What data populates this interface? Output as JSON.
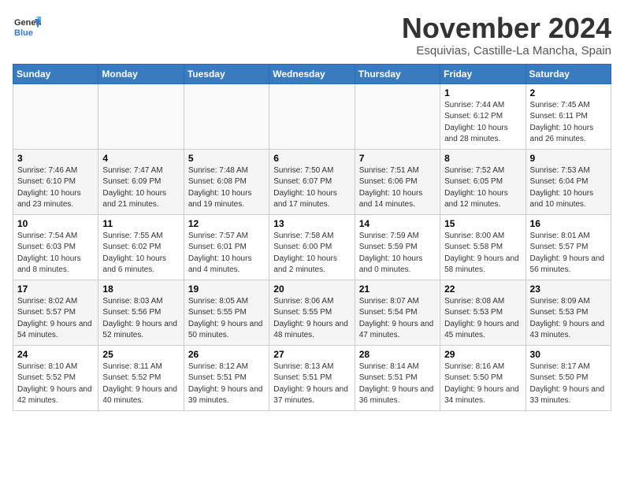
{
  "header": {
    "logo_line1": "General",
    "logo_line2": "Blue",
    "month_year": "November 2024",
    "location": "Esquivias, Castille-La Mancha, Spain"
  },
  "weekdays": [
    "Sunday",
    "Monday",
    "Tuesday",
    "Wednesday",
    "Thursday",
    "Friday",
    "Saturday"
  ],
  "weeks": [
    [
      {
        "day": "",
        "info": ""
      },
      {
        "day": "",
        "info": ""
      },
      {
        "day": "",
        "info": ""
      },
      {
        "day": "",
        "info": ""
      },
      {
        "day": "",
        "info": ""
      },
      {
        "day": "1",
        "info": "Sunrise: 7:44 AM\nSunset: 6:12 PM\nDaylight: 10 hours and 28 minutes."
      },
      {
        "day": "2",
        "info": "Sunrise: 7:45 AM\nSunset: 6:11 PM\nDaylight: 10 hours and 26 minutes."
      }
    ],
    [
      {
        "day": "3",
        "info": "Sunrise: 7:46 AM\nSunset: 6:10 PM\nDaylight: 10 hours and 23 minutes."
      },
      {
        "day": "4",
        "info": "Sunrise: 7:47 AM\nSunset: 6:09 PM\nDaylight: 10 hours and 21 minutes."
      },
      {
        "day": "5",
        "info": "Sunrise: 7:48 AM\nSunset: 6:08 PM\nDaylight: 10 hours and 19 minutes."
      },
      {
        "day": "6",
        "info": "Sunrise: 7:50 AM\nSunset: 6:07 PM\nDaylight: 10 hours and 17 minutes."
      },
      {
        "day": "7",
        "info": "Sunrise: 7:51 AM\nSunset: 6:06 PM\nDaylight: 10 hours and 14 minutes."
      },
      {
        "day": "8",
        "info": "Sunrise: 7:52 AM\nSunset: 6:05 PM\nDaylight: 10 hours and 12 minutes."
      },
      {
        "day": "9",
        "info": "Sunrise: 7:53 AM\nSunset: 6:04 PM\nDaylight: 10 hours and 10 minutes."
      }
    ],
    [
      {
        "day": "10",
        "info": "Sunrise: 7:54 AM\nSunset: 6:03 PM\nDaylight: 10 hours and 8 minutes."
      },
      {
        "day": "11",
        "info": "Sunrise: 7:55 AM\nSunset: 6:02 PM\nDaylight: 10 hours and 6 minutes."
      },
      {
        "day": "12",
        "info": "Sunrise: 7:57 AM\nSunset: 6:01 PM\nDaylight: 10 hours and 4 minutes."
      },
      {
        "day": "13",
        "info": "Sunrise: 7:58 AM\nSunset: 6:00 PM\nDaylight: 10 hours and 2 minutes."
      },
      {
        "day": "14",
        "info": "Sunrise: 7:59 AM\nSunset: 5:59 PM\nDaylight: 10 hours and 0 minutes."
      },
      {
        "day": "15",
        "info": "Sunrise: 8:00 AM\nSunset: 5:58 PM\nDaylight: 9 hours and 58 minutes."
      },
      {
        "day": "16",
        "info": "Sunrise: 8:01 AM\nSunset: 5:57 PM\nDaylight: 9 hours and 56 minutes."
      }
    ],
    [
      {
        "day": "17",
        "info": "Sunrise: 8:02 AM\nSunset: 5:57 PM\nDaylight: 9 hours and 54 minutes."
      },
      {
        "day": "18",
        "info": "Sunrise: 8:03 AM\nSunset: 5:56 PM\nDaylight: 9 hours and 52 minutes."
      },
      {
        "day": "19",
        "info": "Sunrise: 8:05 AM\nSunset: 5:55 PM\nDaylight: 9 hours and 50 minutes."
      },
      {
        "day": "20",
        "info": "Sunrise: 8:06 AM\nSunset: 5:55 PM\nDaylight: 9 hours and 48 minutes."
      },
      {
        "day": "21",
        "info": "Sunrise: 8:07 AM\nSunset: 5:54 PM\nDaylight: 9 hours and 47 minutes."
      },
      {
        "day": "22",
        "info": "Sunrise: 8:08 AM\nSunset: 5:53 PM\nDaylight: 9 hours and 45 minutes."
      },
      {
        "day": "23",
        "info": "Sunrise: 8:09 AM\nSunset: 5:53 PM\nDaylight: 9 hours and 43 minutes."
      }
    ],
    [
      {
        "day": "24",
        "info": "Sunrise: 8:10 AM\nSunset: 5:52 PM\nDaylight: 9 hours and 42 minutes."
      },
      {
        "day": "25",
        "info": "Sunrise: 8:11 AM\nSunset: 5:52 PM\nDaylight: 9 hours and 40 minutes."
      },
      {
        "day": "26",
        "info": "Sunrise: 8:12 AM\nSunset: 5:51 PM\nDaylight: 9 hours and 39 minutes."
      },
      {
        "day": "27",
        "info": "Sunrise: 8:13 AM\nSunset: 5:51 PM\nDaylight: 9 hours and 37 minutes."
      },
      {
        "day": "28",
        "info": "Sunrise: 8:14 AM\nSunset: 5:51 PM\nDaylight: 9 hours and 36 minutes."
      },
      {
        "day": "29",
        "info": "Sunrise: 8:16 AM\nSunset: 5:50 PM\nDaylight: 9 hours and 34 minutes."
      },
      {
        "day": "30",
        "info": "Sunrise: 8:17 AM\nSunset: 5:50 PM\nDaylight: 9 hours and 33 minutes."
      }
    ]
  ]
}
